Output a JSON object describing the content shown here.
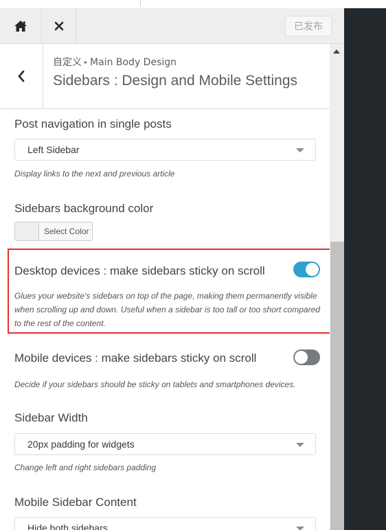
{
  "header": {
    "home_icon": "home-icon",
    "close_icon": "close-icon",
    "publish_label": "已发布"
  },
  "section": {
    "back_icon": "chevron-left-icon",
    "breadcrumb_root": "自定义",
    "breadcrumb_parent": "Main Body Design",
    "title": "Sidebars : Design and Mobile Settings"
  },
  "settings": {
    "post_nav": {
      "label": "Post navigation in single posts",
      "value": "Left Sidebar",
      "description": "Display links to the next and previous article"
    },
    "bg_color": {
      "label": "Sidebars background color",
      "button_label": "Select Color"
    },
    "desktop_sticky": {
      "label": "Desktop devices : make sidebars sticky on scroll",
      "enabled": true,
      "description": "Glues your website's sidebars on top of the page, making them permanently visible when scrolling up and down. Useful when a sidebar is too tall or too short compared to the rest of the content."
    },
    "mobile_sticky": {
      "label": "Mobile devices : make sidebars sticky on scroll",
      "enabled": false,
      "description": "Decide if your sidebars should be sticky on tablets and smartphones devices."
    },
    "sidebar_width": {
      "label": "Sidebar Width",
      "value": "20px padding for widgets",
      "description": "Change left and right sidebars padding"
    },
    "mobile_content": {
      "label": "Mobile Sidebar Content",
      "value": "Hide both sidebars"
    }
  },
  "colors": {
    "toggle_on": "#2ea2cc",
    "toggle_off": "#777b7e",
    "highlight_border": "#e52d2d",
    "right_panel": "#23282d"
  }
}
